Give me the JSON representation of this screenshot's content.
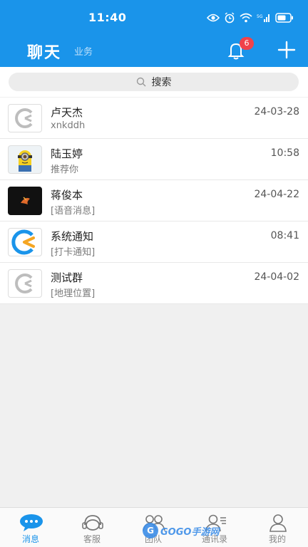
{
  "status_bar": {
    "time": "11:40"
  },
  "header": {
    "title": "聊天",
    "subtitle": "业务",
    "notification_count": "6"
  },
  "search": {
    "placeholder": "搜索"
  },
  "chats": [
    {
      "name": "卢天杰",
      "preview": "xnkddh",
      "time": "24-03-28",
      "avatar": "app-logo-gray"
    },
    {
      "name": "陆玉婷",
      "preview": "推荐你",
      "time": "10:58",
      "avatar": "minion"
    },
    {
      "name": "蒋俊本",
      "preview": "[语音消息]",
      "time": "24-04-22",
      "avatar": "dark-photo"
    },
    {
      "name": "系统通知",
      "preview": "[打卡通知]",
      "time": "08:41",
      "avatar": "app-logo-blue"
    },
    {
      "name": "测试群",
      "preview": "[地理位置]",
      "time": "24-04-02",
      "avatar": "app-logo-gray"
    }
  ],
  "tabbar": {
    "tabs": [
      {
        "label": "消息",
        "icon": "chat-bubble-icon",
        "active": true
      },
      {
        "label": "客服",
        "icon": "headset-icon"
      },
      {
        "label": "团队",
        "icon": "group-icon"
      },
      {
        "label": "通讯录",
        "icon": "contacts-icon"
      },
      {
        "label": "我的",
        "icon": "person-icon"
      }
    ]
  },
  "watermark": {
    "text": "GOGO手游网"
  },
  "colors": {
    "primary": "#1a94ea",
    "badge": "#f0424a",
    "background": "#f0f0f0"
  }
}
